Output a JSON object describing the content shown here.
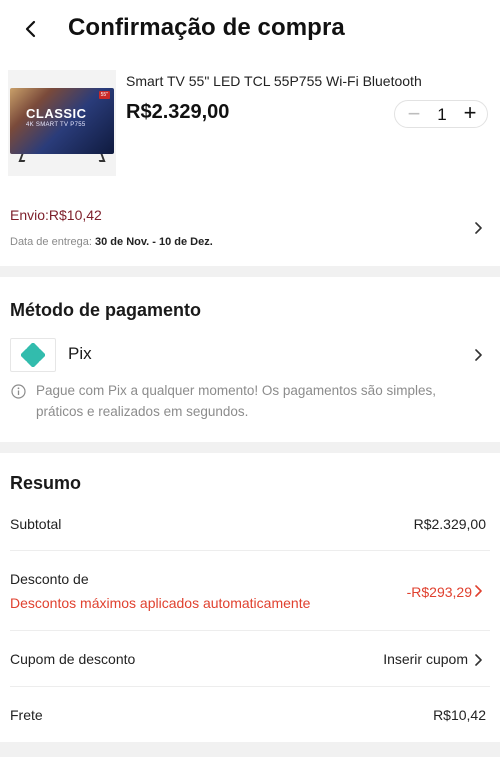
{
  "header": {
    "title": "Confirmação de compra"
  },
  "product": {
    "name": "Smart TV 55\" LED TCL 55P755 Wi-Fi Bluetooth",
    "price": "R$2.329,00",
    "quantity": "1",
    "minus": "−",
    "plus": "+"
  },
  "shipping": {
    "fee": "Envio:R$10,42",
    "date_label": "Data de entrega:",
    "date_value": "30 de Nov. - 10 de Dez."
  },
  "payment": {
    "title": "Método de pagamento",
    "method": "Pix",
    "info": "Pague com Pix a qualquer momento! Os pagamentos são simples, práticos e realizados em segundos."
  },
  "summary": {
    "title": "Resumo",
    "subtotal_label": "Subtotal",
    "subtotal_value": "R$2.329,00",
    "discount_label": "Desconto de",
    "discount_note": "Descontos máximos aplicados automaticamente",
    "discount_value": "-R$293,29",
    "coupon_label": "Cupom de desconto",
    "coupon_action": "Inserir cupom",
    "freight_label": "Frete",
    "freight_value": "R$10,42"
  },
  "colors": {
    "accent_discount": "#e0412f",
    "shipping_fee": "#7d1f2a",
    "pix": "#32bcad"
  },
  "icons": [
    "back-arrow-icon",
    "chevron-right-icon",
    "pix-icon",
    "info-icon"
  ]
}
